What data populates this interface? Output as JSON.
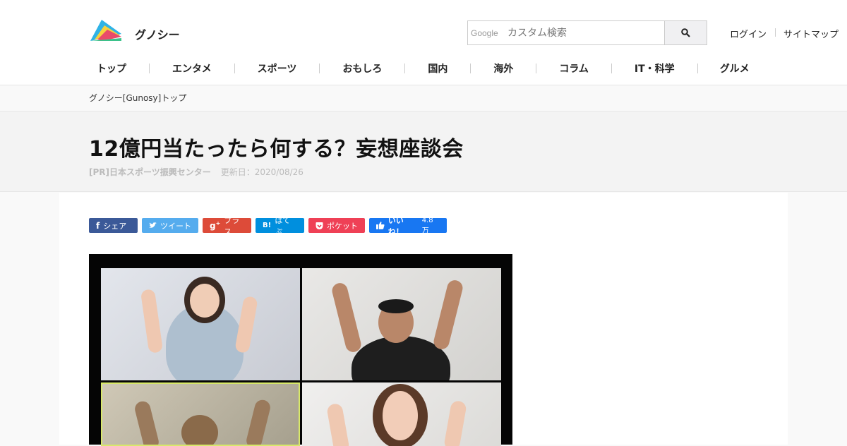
{
  "header": {
    "brand": "グノシー",
    "search": {
      "google_mark": "Google",
      "placeholder": "カスタム検索"
    },
    "links": [
      "ログイン",
      "サイトマップ"
    ]
  },
  "nav": [
    "トップ",
    "エンタメ",
    "スポーツ",
    "おもしろ",
    "国内",
    "海外",
    "コラム",
    "IT・科学",
    "グルメ"
  ],
  "breadcrumb": "グノシー[Gunosy]トップ",
  "article": {
    "title": "12億円当たったら何する？妄想座談会",
    "author": "[PR]日本スポーツ振興センター",
    "updated": "更新日：2020/08/26"
  },
  "share": [
    {
      "label": "シェア",
      "icon": "f",
      "color": "#3b5998"
    },
    {
      "label": "ツイート",
      "icon": "twitter-icon",
      "color": "#55acee"
    },
    {
      "label": "プラス",
      "icon": "g+",
      "color": "#dd4b39"
    },
    {
      "label": "はてぶ",
      "icon": "B!",
      "color": "#008fde"
    },
    {
      "label": "ポケット",
      "icon": "pocket-icon",
      "color": "#ef4056"
    },
    {
      "label": "いいね！",
      "count": "4.8万",
      "icon": "thumbs-up-icon",
      "color": "#1877f2"
    }
  ]
}
